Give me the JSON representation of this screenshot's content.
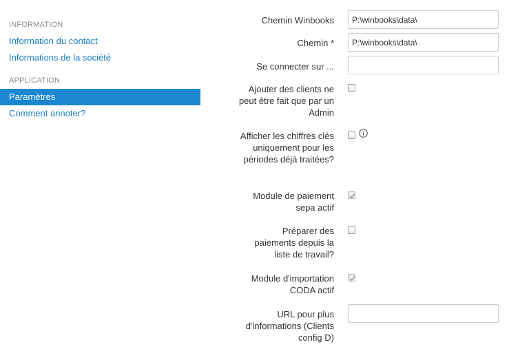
{
  "sidebar": {
    "section_information": "INFORMATION",
    "contact_info": "Information du contact",
    "company_info": "Informations de la société",
    "section_application": "APPLICATION",
    "settings": "Paramètres",
    "how_to_annotate": "Comment annoter?"
  },
  "form": {
    "winbooks_path": {
      "label": "Chemin Winbooks",
      "value": "P:\\winbooks\\data\\"
    },
    "path": {
      "label": "Chemin *",
      "value": "P:\\winbooks\\data\\"
    },
    "connect_on": {
      "label": "Se connecter sur ...",
      "value": ""
    },
    "add_clients_admin_only": {
      "label": "Ajouter des clients ne peut être fait que par un Admin",
      "checked": false
    },
    "show_key_figures_processed": {
      "label": "Afficher les chiffres clés uniquement pour les périodes déjà traitées?",
      "checked": false,
      "icon": "info-icon"
    },
    "sepa_module_active": {
      "label": "Module de paiement sepa actif",
      "checked": true,
      "disabled": true
    },
    "prepare_payments_worklist": {
      "label": "Préparer des paiements depuis la liste de travail?",
      "checked": false
    },
    "coda_import_active": {
      "label": "Module d'importation CODA actif",
      "checked": true,
      "disabled": true
    },
    "more_info_url": {
      "label": "URL pour plus d'informations (Clients config D)",
      "value": ""
    }
  },
  "colors": {
    "accent": "#1a87d0",
    "link": "#1a7fc1",
    "text": "#333333",
    "muted": "#8a8a8a"
  }
}
